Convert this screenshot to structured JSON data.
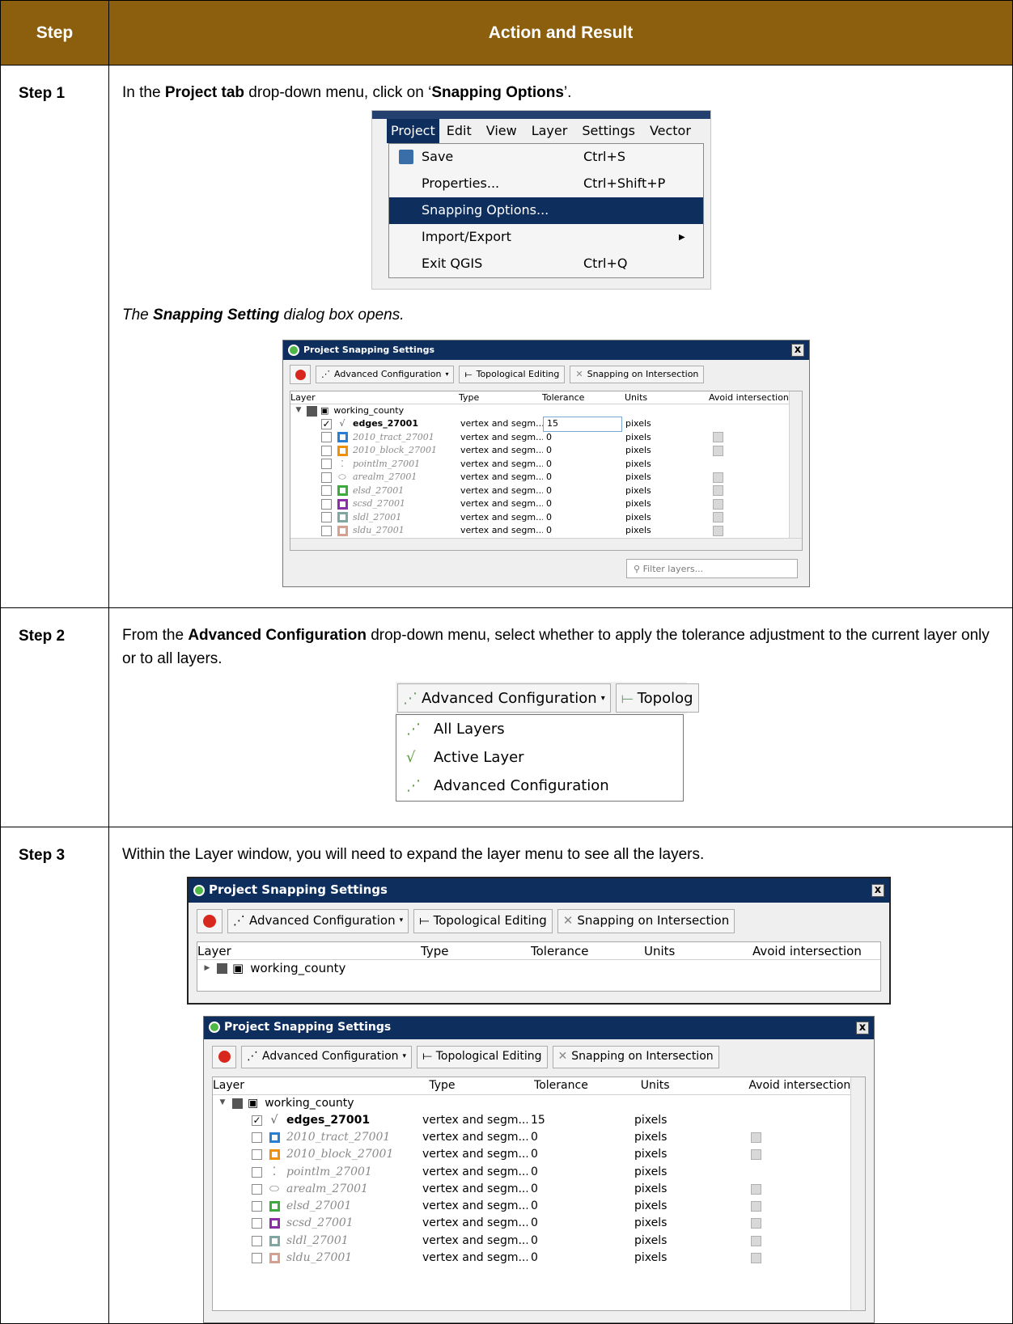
{
  "header": {
    "step": "Step",
    "action": "Action and Result"
  },
  "step1": {
    "label": "Step 1",
    "text_pre": "In the ",
    "text_bold1": "Project tab",
    "text_mid": " drop-down menu, click on ‘",
    "text_bold2": "Snapping Options",
    "text_post": "’.",
    "menu": {
      "bar": [
        "Project",
        "Edit",
        "View",
        "Layer",
        "Settings",
        "Vector"
      ],
      "items": [
        {
          "label": "Save",
          "shortcut": "Ctrl+S"
        },
        {
          "label": "Properties...",
          "shortcut": "Ctrl+Shift+P"
        },
        {
          "label": "Snapping Options...",
          "shortcut": ""
        },
        {
          "label": "Import/Export",
          "shortcut": ""
        },
        {
          "label": "Exit QGIS",
          "shortcut": "Ctrl+Q"
        }
      ]
    },
    "result_pre": "The ",
    "result_bold": "Snapping Setting",
    "result_post": " dialog box opens."
  },
  "dialog": {
    "title": "Project Snapping Settings",
    "close": "x",
    "btn_advanced": "Advanced Configuration",
    "btn_topological": "Topological Editing",
    "btn_intersection": "Snapping on Intersection",
    "columns": [
      "Layer",
      "Type",
      "Tolerance",
      "Units",
      "Avoid intersection"
    ],
    "group": "working_county",
    "filter_placeholder": "Filter layers...",
    "layers": [
      {
        "name": "edges_27001",
        "type": "vertex and segm...",
        "tolerance": "15",
        "units": "pixels",
        "checked": true,
        "bold": true,
        "color": "",
        "avoid": false
      },
      {
        "name": "2010_tract_27001",
        "type": "vertex and segm...",
        "tolerance": "0",
        "units": "pixels",
        "checked": false,
        "bold": false,
        "color": "#2a7fd0",
        "avoid": true
      },
      {
        "name": "2010_block_27001",
        "type": "vertex and segm...",
        "tolerance": "0",
        "units": "pixels",
        "checked": false,
        "bold": false,
        "color": "#f0900a",
        "avoid": true
      },
      {
        "name": "pointlm_27001",
        "type": "vertex and segm...",
        "tolerance": "0",
        "units": "pixels",
        "checked": false,
        "bold": false,
        "color": "",
        "avoid": false
      },
      {
        "name": "arealm_27001",
        "type": "vertex and segm...",
        "tolerance": "0",
        "units": "pixels",
        "checked": false,
        "bold": false,
        "color": "",
        "avoid": true
      },
      {
        "name": "elsd_27001",
        "type": "vertex and segm...",
        "tolerance": "0",
        "units": "pixels",
        "checked": false,
        "bold": false,
        "color": "#3caa3c",
        "avoid": true
      },
      {
        "name": "scsd_27001",
        "type": "vertex and segm...",
        "tolerance": "0",
        "units": "pixels",
        "checked": false,
        "bold": false,
        "color": "#8b2fa8",
        "avoid": true
      },
      {
        "name": "sldl_27001",
        "type": "vertex and segm...",
        "tolerance": "0",
        "units": "pixels",
        "checked": false,
        "bold": false,
        "color": "#7fa6a0",
        "avoid": true
      },
      {
        "name": "sldu_27001",
        "type": "vertex and segm...",
        "tolerance": "0",
        "units": "pixels",
        "checked": false,
        "bold": false,
        "color": "#d4a090",
        "avoid": true
      }
    ]
  },
  "step2": {
    "label": "Step 2",
    "text_pre": "From the ",
    "text_bold": "Advanced Configuration",
    "text_post": " drop-down menu, select whether to apply the tolerance adjustment to the current layer only or to all layers.",
    "menu_button": "Advanced Configuration",
    "menu_button2": "Topolog",
    "items": [
      "All Layers",
      "Active Layer",
      "Advanced Configuration"
    ]
  },
  "step3": {
    "label": "Step 3",
    "text": "Within the Layer window, you will need to expand the layer menu to see all the layers."
  }
}
